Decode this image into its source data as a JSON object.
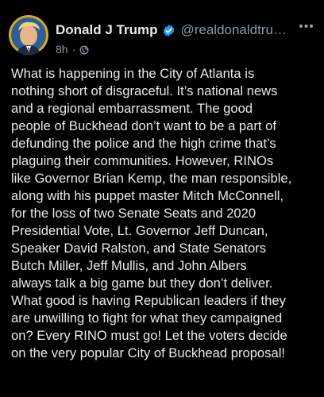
{
  "post": {
    "author_name": "Donald J Trump",
    "handle": "@realdonaldtru…",
    "time_ago": "8h",
    "meta_separator": "·",
    "more_label": "•••",
    "body": "What is happening in the City of Atlanta is\nnothing short of disgraceful. It’s national news\nand a regional embarrassment. The good\npeople of Buckhead don’t want to be a part of\ndefunding the police and the high crime that’s\nplaguing their communities. However, RINOs\nlike Governor Brian Kemp, the man responsible,\nalong with his puppet master Mitch McConnell,\nfor the loss of two Senate Seats and 2020\nPresidential Vote, Lt. Governor Jeff Duncan,\nSpeaker David Ralston, and State Senators\nButch Miller, Jeff Mullis, and John Albers\nalways talk a big game but they don’t deliver.\nWhat good is having Republican leaders if they\nare unwilling to fight for what they campaigned\non? Every RINO must go! Let the voters decide\non the very popular City of Buckhead proposal!"
  },
  "icons": {
    "avatar": "avatar-photo",
    "verified": "verified-badge-icon",
    "visibility": "globe-icon",
    "more": "more-options-icon"
  },
  "colors": {
    "background": "#000000",
    "text": "#e7e9ea",
    "muted": "#8b98a5",
    "verified_badge": "#1d9bf0",
    "avatar_ring": "#d4a62a"
  }
}
